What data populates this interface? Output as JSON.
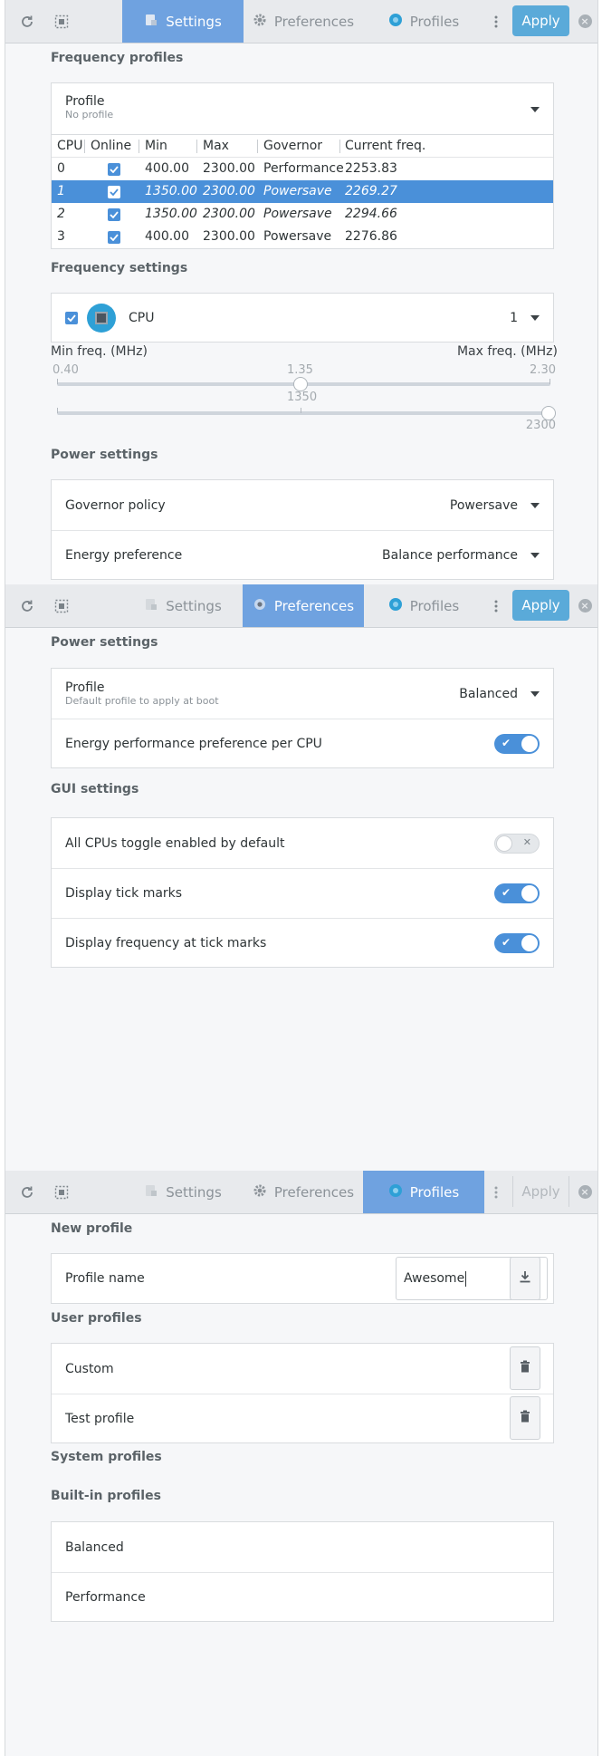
{
  "headerbar": {
    "tabs": [
      "Settings",
      "Preferences",
      "Profiles"
    ],
    "apply_label": "Apply"
  },
  "settings": {
    "freq_profiles_title": "Frequency profiles",
    "profile_label": "Profile",
    "profile_sub": "No profile",
    "table_headers": [
      "CPU",
      "Online",
      "Min",
      "Max",
      "Governor",
      "Current freq."
    ],
    "table_rows": [
      {
        "cpu": "0",
        "online": true,
        "min": "400.00",
        "max": "2300.00",
        "governor": "Performance",
        "current": "2253.83"
      },
      {
        "cpu": "1",
        "online": true,
        "min": "1350.00",
        "max": "2300.00",
        "governor": "Powersave",
        "current": "2269.27"
      },
      {
        "cpu": "2",
        "online": true,
        "min": "1350.00",
        "max": "2300.00",
        "governor": "Powersave",
        "current": "2294.66"
      },
      {
        "cpu": "3",
        "online": true,
        "min": "400.00",
        "max": "2300.00",
        "governor": "Powersave",
        "current": "2276.86"
      }
    ],
    "freq_settings_title": "Frequency settings",
    "cpu_label": "CPU",
    "cpu_selected": "1",
    "min_freq_label": "Min freq. (MHz)",
    "max_freq_label": "Max freq. (MHz)",
    "tick_min": "0.40",
    "tick_mid": "1.35",
    "tick_max": "2.30",
    "min_slider_value": "1350",
    "max_slider_value": "2300",
    "power_settings_title": "Power settings",
    "governor_label": "Governor policy",
    "governor_value": "Powersave",
    "energy_label": "Energy preference",
    "energy_value": "Balance performance"
  },
  "preferences": {
    "power_settings_title": "Power settings",
    "profile_label": "Profile",
    "profile_sub": "Default profile to apply at boot",
    "profile_value": "Balanced",
    "epp_label": "Energy performance preference per CPU",
    "gui_settings_title": "GUI settings",
    "all_cpus_label": "All CPUs toggle enabled by default",
    "tick_marks_label": "Display tick marks",
    "freq_ticks_label": "Display frequency at tick marks"
  },
  "profiles": {
    "new_profile_title": "New profile",
    "profile_name_label": "Profile name",
    "profile_name_value": "Awesome",
    "user_profiles_title": "User profiles",
    "user_profiles": [
      "Custom",
      "Test profile"
    ],
    "system_profiles_title": "System profiles",
    "builtin_profiles_title": "Built-in profiles",
    "builtin_profiles": [
      "Balanced",
      "Performance"
    ]
  },
  "colors": {
    "accent": "#4a90d9",
    "active_tab": "#6fa2e0",
    "apply_button": "#5aaad9"
  }
}
